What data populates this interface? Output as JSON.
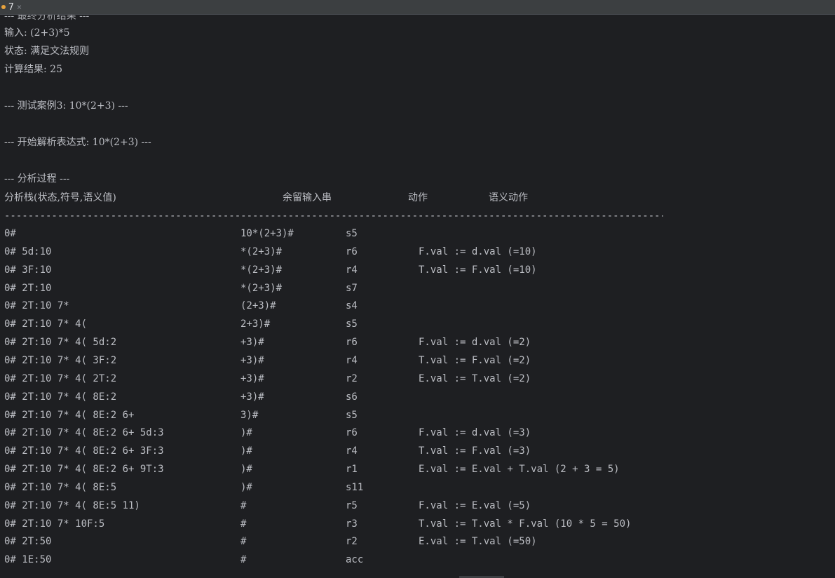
{
  "tab": {
    "title": "7",
    "close_glyph": "×"
  },
  "output": {
    "partial_top": "--- 最终分析结果 ---",
    "input_line": "输入: (2+3)*5",
    "status_line": "状态: 满足文法规则",
    "result_line": "计算结果: 25",
    "test_case_line": "--- 测试案例3: 10*(2+3) ---",
    "start_line": "--- 开始解析表达式: 10*(2+3) ---",
    "process_line": "--- 分析过程 ---",
    "dashes": "--------------------------------------------------------------------------------------------------------------------"
  },
  "table": {
    "headers": {
      "stack": "分析栈(状态,符号,语义值)",
      "input": "余留输入串",
      "action": "动作",
      "semantic": "语义动作"
    },
    "rows": [
      {
        "stack": "0#",
        "input": "10*(2+3)#",
        "action": "s5",
        "semantic": ""
      },
      {
        "stack": "0# 5d:10",
        "input": "*(2+3)#",
        "action": "r6",
        "semantic": "F.val := d.val (=10)"
      },
      {
        "stack": "0# 3F:10",
        "input": "*(2+3)#",
        "action": "r4",
        "semantic": "T.val := F.val (=10)"
      },
      {
        "stack": "0# 2T:10",
        "input": "*(2+3)#",
        "action": "s7",
        "semantic": ""
      },
      {
        "stack": "0# 2T:10 7*",
        "input": "(2+3)#",
        "action": "s4",
        "semantic": ""
      },
      {
        "stack": "0# 2T:10 7* 4(",
        "input": "2+3)#",
        "action": "s5",
        "semantic": ""
      },
      {
        "stack": "0# 2T:10 7* 4( 5d:2",
        "input": "+3)#",
        "action": "r6",
        "semantic": "F.val := d.val (=2)"
      },
      {
        "stack": "0# 2T:10 7* 4( 3F:2",
        "input": "+3)#",
        "action": "r4",
        "semantic": "T.val := F.val (=2)"
      },
      {
        "stack": "0# 2T:10 7* 4( 2T:2",
        "input": "+3)#",
        "action": "r2",
        "semantic": "E.val := T.val (=2)"
      },
      {
        "stack": "0# 2T:10 7* 4( 8E:2",
        "input": "+3)#",
        "action": "s6",
        "semantic": ""
      },
      {
        "stack": "0# 2T:10 7* 4( 8E:2 6+",
        "input": "3)#",
        "action": "s5",
        "semantic": ""
      },
      {
        "stack": "0# 2T:10 7* 4( 8E:2 6+ 5d:3",
        "input": ")#",
        "action": "r6",
        "semantic": "F.val := d.val (=3)"
      },
      {
        "stack": "0# 2T:10 7* 4( 8E:2 6+ 3F:3",
        "input": ")#",
        "action": "r4",
        "semantic": "T.val := F.val (=3)"
      },
      {
        "stack": "0# 2T:10 7* 4( 8E:2 6+ 9T:3",
        "input": ")#",
        "action": "r1",
        "semantic": "E.val := E.val + T.val (2 + 3 = 5)"
      },
      {
        "stack": "0# 2T:10 7* 4( 8E:5",
        "input": ")#",
        "action": "s11",
        "semantic": ""
      },
      {
        "stack": "0# 2T:10 7* 4( 8E:5 11)",
        "input": "#",
        "action": "r5",
        "semantic": "F.val := E.val (=5)"
      },
      {
        "stack": "0# 2T:10 7* 10F:5",
        "input": "#",
        "action": "r3",
        "semantic": "T.val := T.val * F.val (10 * 5 = 50)"
      },
      {
        "stack": "0# 2T:50",
        "input": "#",
        "action": "r2",
        "semantic": "E.val := T.val (=50)"
      },
      {
        "stack": "0# 1E:50",
        "input": "#",
        "action": "acc",
        "semantic": ""
      }
    ]
  }
}
